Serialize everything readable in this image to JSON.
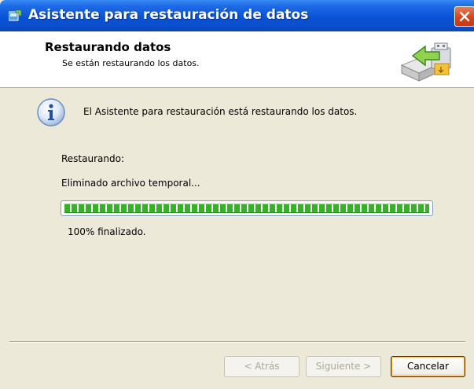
{
  "window": {
    "title": "Asistente para restauración de datos",
    "app_icon": "restore-wizard-app-icon",
    "close_icon": "close-icon"
  },
  "header": {
    "title": "Restaurando datos",
    "subtitle": "Se están restaurando los datos.",
    "icon": "restore-drive-arrow-icon"
  },
  "body": {
    "info_icon": "info-icon",
    "info_text": "El Asistente para restauración está restaurando los datos.",
    "status_label": "Restaurando:",
    "status_detail": "Eliminado archivo temporal...",
    "progress_percent": 100,
    "progress_text": "100%  finalizado."
  },
  "buttons": {
    "back": "< Atrás",
    "next": "Siguiente >",
    "cancel": "Cancelar"
  },
  "colors": {
    "titlebar": "#0a53d6",
    "progress_fill": "#37b228",
    "dialog_bg": "#ece9d8"
  }
}
